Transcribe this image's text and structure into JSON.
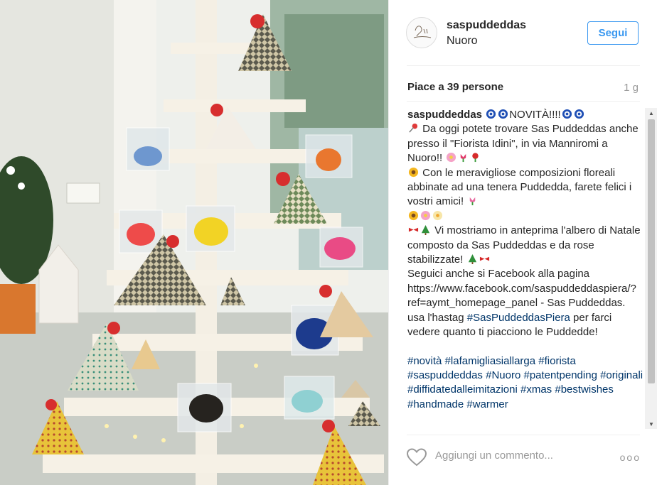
{
  "post": {
    "username": "saspuddeddas",
    "location": "Nuoro",
    "follow_label": "Segui",
    "likes": "Piace a 39 persone",
    "time": "1 g",
    "avatar_text": "Sas Puddeddas"
  },
  "caption": {
    "username": "saspuddeddas",
    "lines": [
      "NOVITÀ!!!!",
      "Da oggi potete trovare Sas Puddeddas anche presso il \"Fiorista Idini\", in via Manniromi a Nuoro!!",
      "Con le meravigliose composizioni floreali abbinate ad una tenera Puddedda, farete felici i vostri amici!",
      "Vi mostriamo in anteprima l'albero di Natale composto da Sas Puddeddas e da rose stabilizzate!",
      "Seguici anche si Facebook alla pagina https://www.facebook.com/saspuddeddaspiera/?ref=aymt_homepage_panel - Sas Puddeddas. usa l'hastag",
      "#SasPuddeddasPiera",
      "per farci vedere quanto ti piacciono le Puddedde!"
    ],
    "hashtags": [
      "#novità",
      "#lafamigliasiallarga",
      "#fiorista",
      "#saspuddeddas",
      "#Nuoro",
      "#patentpending",
      "#originali",
      "#diffidatedalleimitazioni",
      "#xmas",
      "#bestwishes",
      "#handmade",
      "#warmer"
    ]
  },
  "footer": {
    "add_comment_placeholder": "Aggiungi un commento...",
    "more_label": "ooo"
  },
  "colors": {
    "follow_blue": "#3897f0",
    "hashtag": "#003569"
  }
}
